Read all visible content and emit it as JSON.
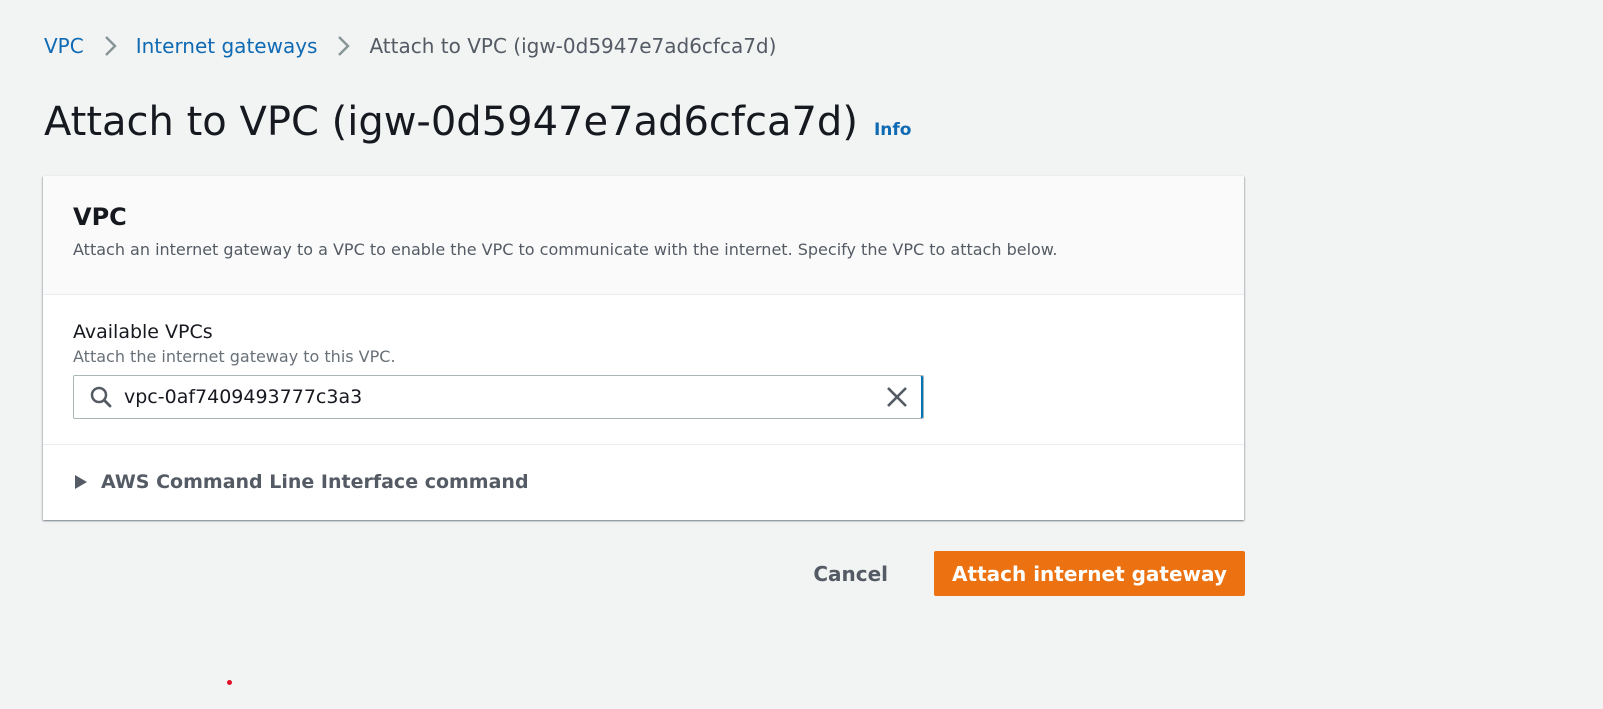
{
  "breadcrumb": {
    "items": [
      {
        "label": "VPC"
      },
      {
        "label": "Internet gateways"
      }
    ],
    "current": "Attach to VPC (igw-0d5947e7ad6cfca7d)"
  },
  "page": {
    "title": "Attach to VPC (igw-0d5947e7ad6cfca7d)",
    "info_label": "Info"
  },
  "panel": {
    "title": "VPC",
    "description": "Attach an internet gateway to a VPC to enable the VPC to communicate with the internet. Specify the VPC to attach below.",
    "field": {
      "label": "Available VPCs",
      "description": "Attach the internet gateway to this VPC.",
      "value": "vpc-0af7409493777c3a3"
    },
    "expandable": {
      "label": "AWS Command Line Interface command"
    }
  },
  "actions": {
    "cancel_label": "Cancel",
    "primary_label": "Attach internet gateway"
  },
  "colors": {
    "link": "#0f6ab4",
    "primary": "#ec7211",
    "background": "#f2f3f3"
  },
  "icons": {
    "breadcrumb_separator": "chevron-right-icon",
    "search": "search-icon",
    "clear": "close-icon",
    "expand": "caret-right-icon"
  }
}
